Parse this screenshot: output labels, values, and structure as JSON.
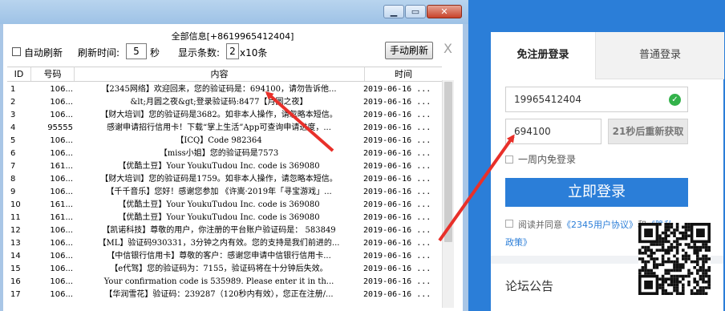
{
  "panel_title": "全部信息[+8619965412404]",
  "toolbar": {
    "auto_refresh": "自动刷新",
    "refresh_time_label": "刷新时间:",
    "refresh_time_value": "5",
    "refresh_time_unit": "秒",
    "show_count_label": "显示条数:",
    "show_count_value": "2",
    "show_count_unit": "x10条",
    "manual_refresh": "手动刷新",
    "close": "X"
  },
  "table": {
    "headers": [
      "ID",
      "号码",
      "内容",
      "时间"
    ],
    "rows": [
      {
        "id": "1",
        "num": "106...",
        "content": "【2345网络】欢迎回来，您的验证码是：694100，请勿告诉他...",
        "time": "2019-06-16 ..."
      },
      {
        "id": "2",
        "num": "106...",
        "content": "&lt;月圆之夜&gt;登录验证码:8477【月圆之夜】",
        "time": "2019-06-16 ..."
      },
      {
        "id": "3",
        "num": "106...",
        "content": "【财大培训】您的验证码是3682。如非本人操作，请忽略本短信。",
        "time": "2019-06-16 ..."
      },
      {
        "id": "4",
        "num": "95555",
        "content": "感谢申请招行信用卡！下载“掌上生活”App可查询申请进度，...",
        "time": "2019-06-16 ..."
      },
      {
        "id": "5",
        "num": "106...",
        "content": "【ICQ】Code 982364",
        "time": "2019-06-16 ..."
      },
      {
        "id": "6",
        "num": "106...",
        "content": "【miss小姐】您的验证码是7573",
        "time": "2019-06-16 ..."
      },
      {
        "id": "7",
        "num": "161...",
        "content": "【优酷土豆】Your YoukuTudou Inc. code is 369080",
        "time": "2019-06-16 ..."
      },
      {
        "id": "8",
        "num": "106...",
        "content": "【财大培训】您的验证码是1759。如非本人操作，请忽略本短信。",
        "time": "2019-06-16 ..."
      },
      {
        "id": "9",
        "num": "106...",
        "content": "【千千音乐】您好！感谢您参加 《许嵩·2019年「寻宝游戏」...",
        "time": "2019-06-16 ..."
      },
      {
        "id": "10",
        "num": "161...",
        "content": "【优酷土豆】Your YoukuTudou Inc. code is 369080",
        "time": "2019-06-16 ..."
      },
      {
        "id": "11",
        "num": "161...",
        "content": "【优酷土豆】Your YoukuTudou Inc. code is 369080",
        "time": "2019-06-16 ..."
      },
      {
        "id": "12",
        "num": "106...",
        "content": "【凯诺科技】尊敬的用户，你注册的平台账户验证码是： 583849",
        "time": "2019-06-16 ..."
      },
      {
        "id": "13",
        "num": "106...",
        "content": "【ML】验证码930331，3分钟之内有效。您的支持是我们前进的...",
        "time": "2019-06-16 ..."
      },
      {
        "id": "14",
        "num": "106...",
        "content": "【中信银行信用卡】尊敬的客户：感谢您申请中信银行信用卡...",
        "time": "2019-06-16 ..."
      },
      {
        "id": "15",
        "num": "106...",
        "content": "【e代驾】您的验证码为：7155，验证码将在十分钟后失效。",
        "time": "2019-06-16 ..."
      },
      {
        "id": "16",
        "num": "106...",
        "content": "Your confirmation code is 535989. Please enter it in th...",
        "time": "2019-06-16 ..."
      },
      {
        "id": "17",
        "num": "106...",
        "content": "【华润雪花】验证码：239287（120秒内有效），您正在注册/...",
        "time": "2019-06-16 ..."
      }
    ]
  },
  "login": {
    "tab_free": "免注册登录",
    "tab_normal": "普通登录",
    "phone_value": "19965412404",
    "code_value": "694100",
    "resend": "21秒后重新获取",
    "remember_week": "一周内免登录",
    "login_button": "立即登录",
    "agree_prefix": "阅读并同意",
    "agree_link1": "《2345用户协议》",
    "agree_and": "和",
    "agree_link2_part1": "《隐私",
    "agree_link2_part2": "政策》",
    "forum_title": "论坛公告"
  },
  "colors": {
    "login_blue": "#2b7ed8",
    "arrow_red": "#e8302a",
    "check_green": "#33b24a"
  }
}
